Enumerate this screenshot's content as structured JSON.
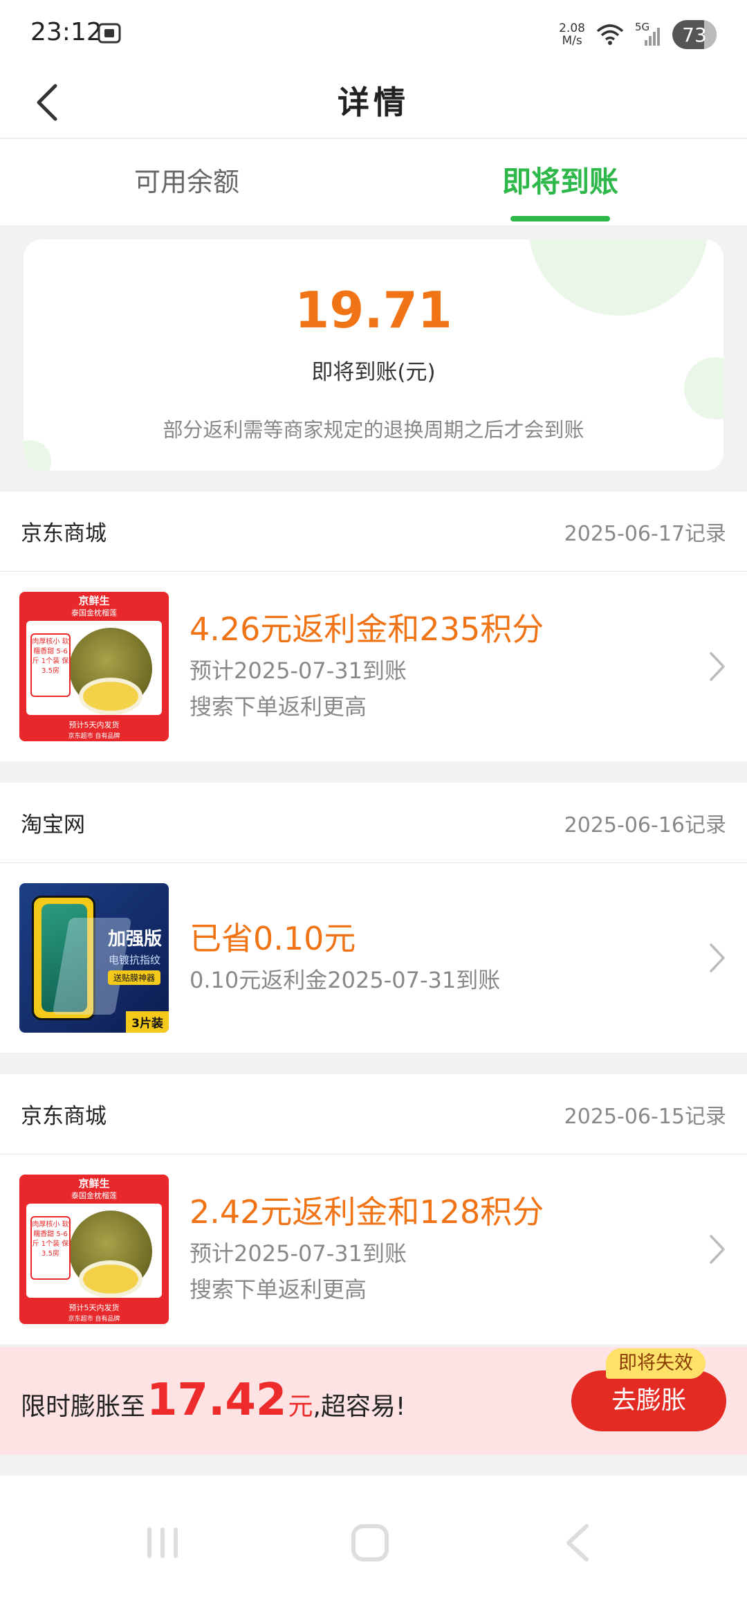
{
  "status_bar": {
    "time": "23:12",
    "speed_value": "2.08",
    "speed_unit": "M/s",
    "network": "5G",
    "battery": "73"
  },
  "header": {
    "title": "详情"
  },
  "tabs": [
    {
      "label": "可用余额",
      "active": false
    },
    {
      "label": "即将到账",
      "active": true
    }
  ],
  "summary": {
    "amount": "19.71",
    "label": "即将到账(元)",
    "note": "部分返利需等商家规定的退换周期之后才会到账"
  },
  "records": [
    {
      "store": "京东商城",
      "date": "2025-06-17记录",
      "main": "4.26元返利金和235积分",
      "sub": "预计2025-07-31到账",
      "sub2": "搜索下单返利更高",
      "thumb": {
        "brand": "京鲜生",
        "line1": "泰国金枕榴莲",
        "badge": "肉厚核小 软糯香甜 5-6斤 1个装 保3.5房",
        "bottom1": "预计5天内发货",
        "bottom2": "京东超市 自有品牌"
      }
    },
    {
      "store": "淘宝网",
      "date": "2025-06-16记录",
      "main": "已省0.10元",
      "sub": "0.10元返利金2025-07-31到账",
      "sub2": "",
      "thumb": {
        "title": "加强版",
        "sub": "电镀抗指纹",
        "tag": "送贴膜神器",
        "pack": "3片装"
      }
    },
    {
      "store": "京东商城",
      "date": "2025-06-15记录",
      "main": "2.42元返利金和128积分",
      "sub": "预计2025-07-31到账",
      "sub2": "搜索下单返利更高",
      "thumb": {
        "brand": "京鲜生",
        "line1": "泰国金枕榴莲",
        "badge": "肉厚核小 软糯香甜 5-6斤 1个装 保3.5房",
        "bottom1": "预计5天内发货",
        "bottom2": "京东超市 自有品牌"
      }
    }
  ],
  "promo": {
    "prefix": "限时膨胀至",
    "amount": "17.42",
    "unit": "元",
    "suffix": ",超容易!",
    "button": "去膨胀",
    "tag": "即将失效"
  },
  "colors": {
    "accent_green": "#2fb84a",
    "amount_orange": "#f07316",
    "promo_red": "#e32a23"
  }
}
